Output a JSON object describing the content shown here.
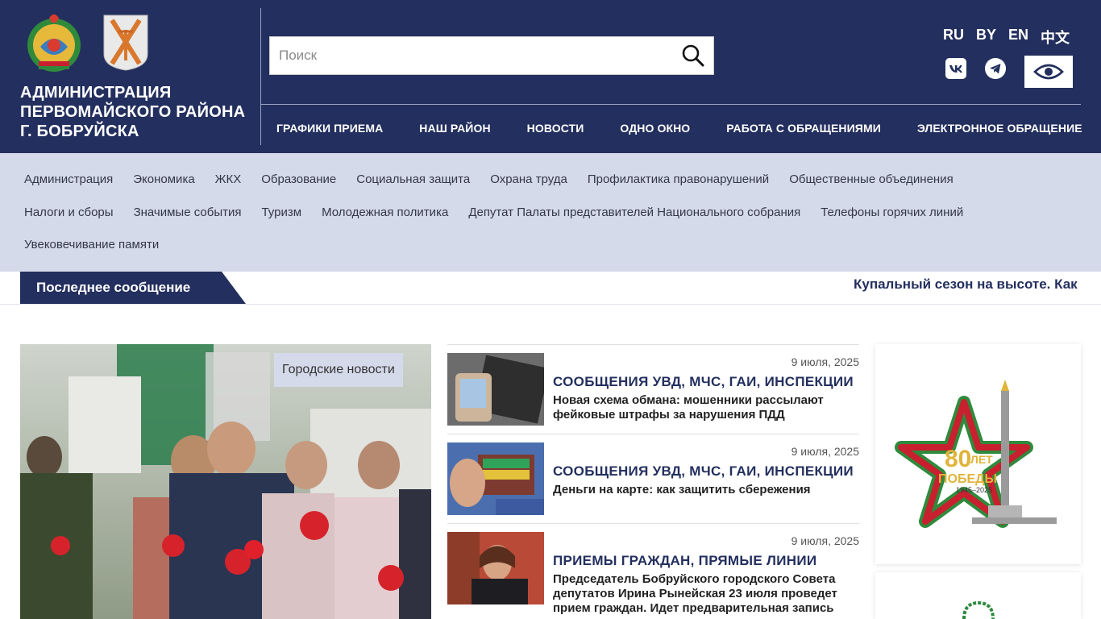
{
  "header": {
    "org_title_line1": "АДМИНИСТРАЦИЯ",
    "org_title_line2": "ПЕРВОМАЙСКОГО РАЙОНА",
    "org_title_line3": "Г. БОБРУЙСКА",
    "search_placeholder": "Поиск",
    "languages": [
      "RU",
      "BY",
      "EN",
      "中文"
    ],
    "nav": [
      "ГРАФИКИ ПРИЕМА",
      "НАШ РАЙОН",
      "НОВОСТИ",
      "ОДНО ОКНО",
      "РАБОТА С ОБРАЩЕНИЯМИ",
      "ЭЛЕКТРОННОЕ ОБРАЩЕНИЕ"
    ]
  },
  "subnav": {
    "row1": [
      "Администрация",
      "Экономика",
      "ЖКХ",
      "Образование",
      "Социальная защита",
      "Охрана труда",
      "Профилактика правонарушений",
      "Общественные объединения"
    ],
    "row2": [
      "Налоги и сборы",
      "Значимые события",
      "Туризм",
      "Молодежная политика",
      "Депутат Палаты представителей Национального собрания",
      "Телефоны горячих линий"
    ],
    "row3": [
      "Увековечивание памяти"
    ]
  },
  "ticker": {
    "label": "Последнее сообщение",
    "text": "Купальный сезон на высоте. Как"
  },
  "feature": {
    "tag": "Городские новости"
  },
  "news": [
    {
      "date": "9 июля, 2025",
      "category": "СООБЩЕНИЯ УВД, МЧС, ГАИ, ИНСПЕКЦИИ",
      "title": "Новая схема обмана: мошенники рассылают фейковые штрафы за нарушения ПДД"
    },
    {
      "date": "9 июля, 2025",
      "category": "СООБЩЕНИЯ УВД, МЧС, ГАИ, ИНСПЕКЦИИ",
      "title": "Деньги на карте: как защитить сбережения"
    },
    {
      "date": "9 июля, 2025",
      "category": "ПРИЕМЫ ГРАЖДАН, ПРЯМЫЕ ЛИНИИ",
      "title": "Председатель Бобруйского городского Совета депутатов Ирина Рынейская 23 июля проведет прием граждан. Идет предварительная запись"
    }
  ],
  "banner": {
    "number": "80",
    "word_top": "ЛЕТ",
    "word_bottom": "ПОБЕДЫ",
    "years": "1945–2025"
  },
  "colors": {
    "header_bg": "#232f5e",
    "subnav_bg": "#d5daeb",
    "accent_red": "#c8202f",
    "accent_green": "#2f8a3c"
  },
  "icons": [
    "state-emblem-icon",
    "city-crest-icon",
    "search-icon",
    "vk-icon",
    "telegram-icon",
    "eye-icon"
  ]
}
